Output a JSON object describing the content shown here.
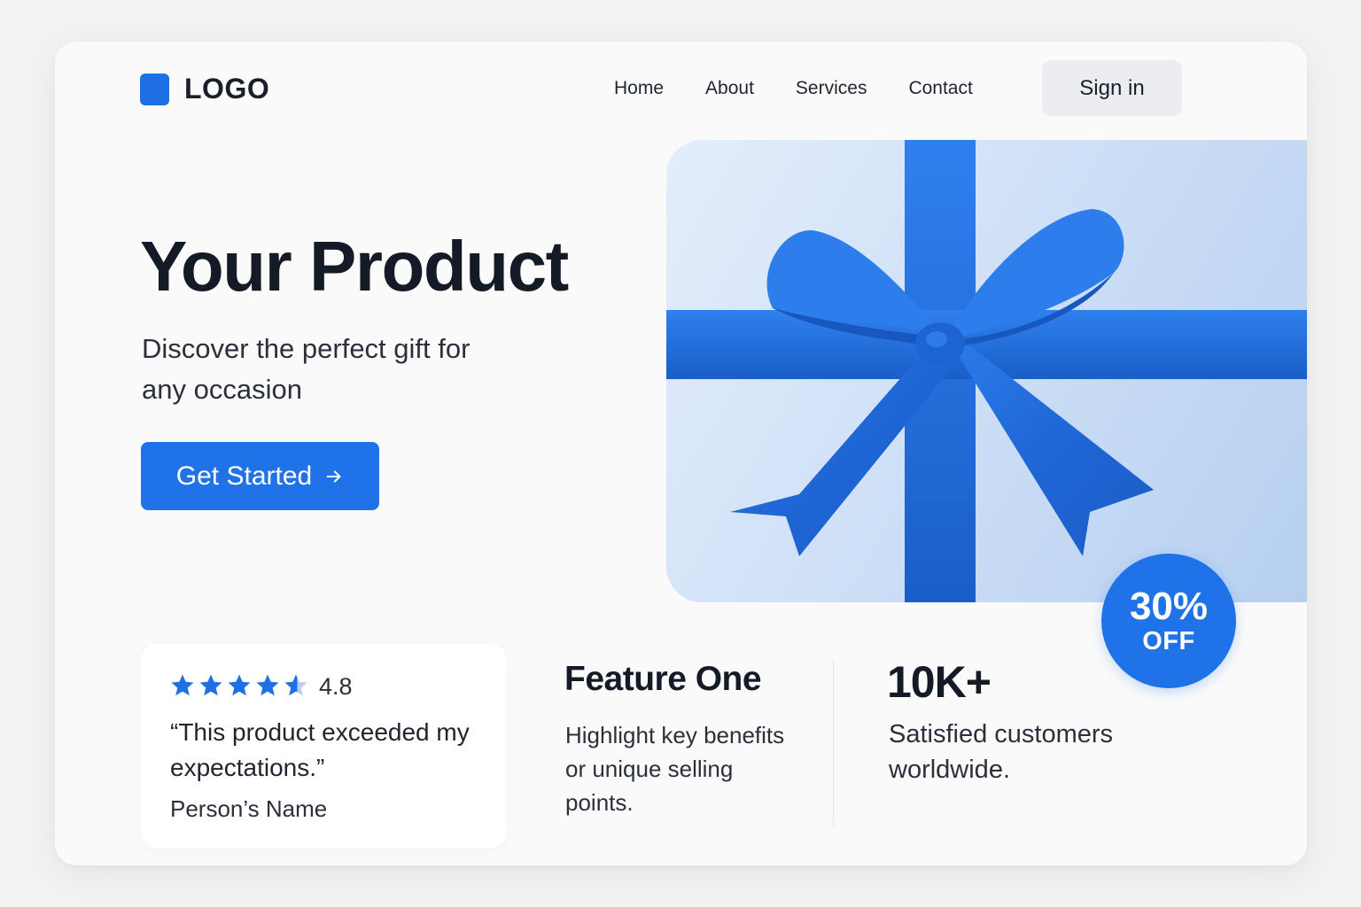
{
  "header": {
    "logo_text": "LOGO",
    "nav": [
      "Home",
      "About",
      "Services",
      "Contact"
    ],
    "signin_label": "Sign in"
  },
  "hero": {
    "title": "Your Product",
    "subtitle": "Discover the perfect gift for any occasion",
    "cta_label": "Get Started",
    "cta_icon": "arrow-right-icon",
    "image": "blue-ribbon-gift-bow",
    "badge": {
      "percent": "30%",
      "off": "OFF"
    }
  },
  "review": {
    "stars": 4.5,
    "rating": "4.8",
    "quote": "“This product exceeded my expectations.”",
    "person": "Person’s Name"
  },
  "feature": {
    "title": "Feature One",
    "text": "Highlight key benefits or unique selling points."
  },
  "stat": {
    "title": "10K+",
    "text": "Satisfied customers worldwide."
  },
  "colors": {
    "accent": "#1f72e8",
    "background": "#fafafa",
    "text": "#141a26",
    "ribbon": "#1f6fdc"
  }
}
